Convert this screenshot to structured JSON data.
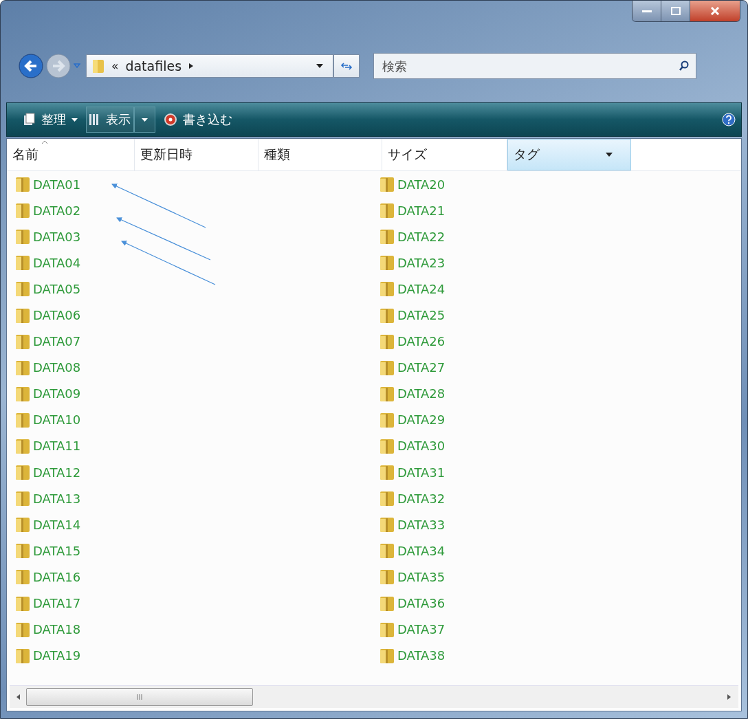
{
  "address": {
    "prefix": "«",
    "folder": "datafiles"
  },
  "search": {
    "placeholder": "検索"
  },
  "toolbar": [
    {
      "label": "整理",
      "kind": "menu"
    },
    {
      "label": "表示",
      "kind": "split"
    },
    {
      "label": "書き込む",
      "kind": "burn"
    }
  ],
  "columns": [
    {
      "label": "名前",
      "sorted": true,
      "highlighted": false
    },
    {
      "label": "更新日時",
      "sorted": false,
      "highlighted": false
    },
    {
      "label": "種類",
      "sorted": false,
      "highlighted": false
    },
    {
      "label": "サイズ",
      "sorted": false,
      "highlighted": false
    },
    {
      "label": "タグ",
      "sorted": false,
      "highlighted": true
    }
  ],
  "items": [
    {
      "name": "DATA01"
    },
    {
      "name": "DATA02"
    },
    {
      "name": "DATA03"
    },
    {
      "name": "DATA04"
    },
    {
      "name": "DATA05"
    },
    {
      "name": "DATA06"
    },
    {
      "name": "DATA07"
    },
    {
      "name": "DATA08"
    },
    {
      "name": "DATA09"
    },
    {
      "name": "DATA10"
    },
    {
      "name": "DATA11"
    },
    {
      "name": "DATA12"
    },
    {
      "name": "DATA13"
    },
    {
      "name": "DATA14"
    },
    {
      "name": "DATA15"
    },
    {
      "name": "DATA16"
    },
    {
      "name": "DATA17"
    },
    {
      "name": "DATA18"
    },
    {
      "name": "DATA19"
    },
    {
      "name": "DATA20"
    },
    {
      "name": "DATA21"
    },
    {
      "name": "DATA22"
    },
    {
      "name": "DATA23"
    },
    {
      "name": "DATA24"
    },
    {
      "name": "DATA25"
    },
    {
      "name": "DATA26"
    },
    {
      "name": "DATA27"
    },
    {
      "name": "DATA28"
    },
    {
      "name": "DATA29"
    },
    {
      "name": "DATA30"
    },
    {
      "name": "DATA31"
    },
    {
      "name": "DATA32"
    },
    {
      "name": "DATA33"
    },
    {
      "name": "DATA34"
    },
    {
      "name": "DATA35"
    },
    {
      "name": "DATA36"
    },
    {
      "name": "DATA37"
    },
    {
      "name": "DATA38"
    }
  ]
}
